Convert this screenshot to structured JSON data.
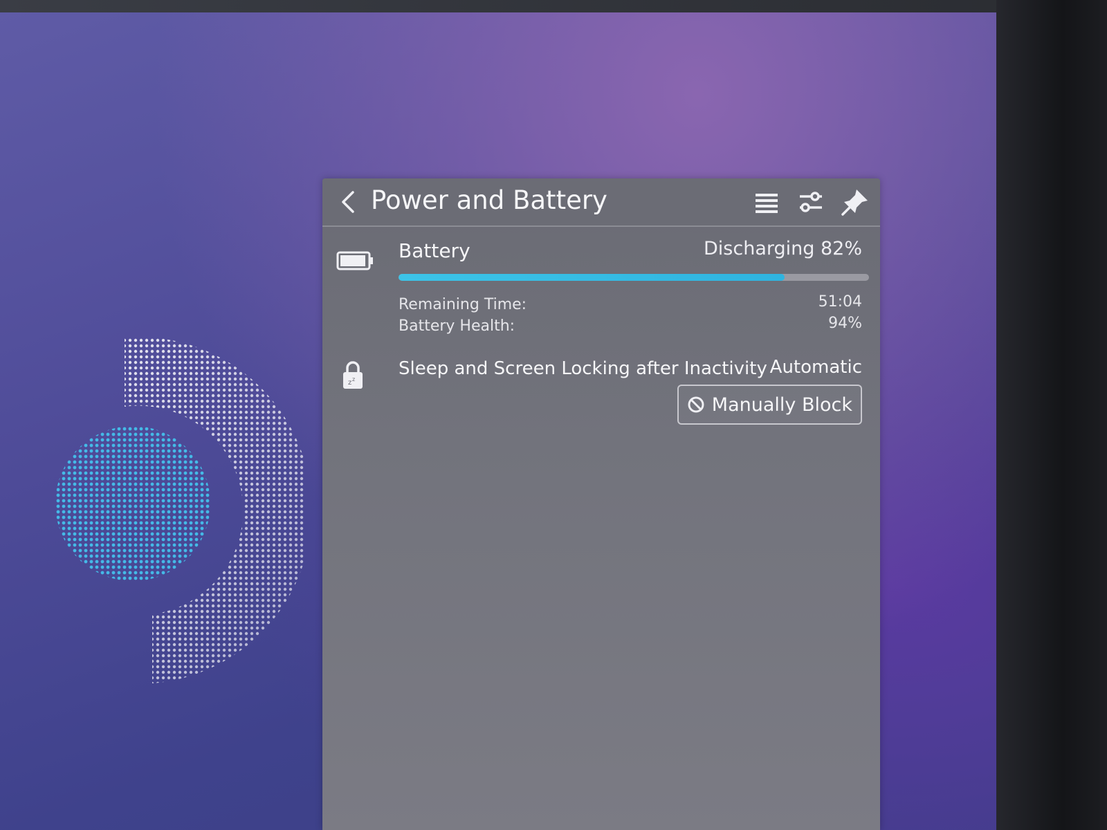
{
  "panel": {
    "title": "Power and Battery"
  },
  "battery": {
    "name": "Battery",
    "status": "Discharging 82%",
    "charge_percent": 82,
    "remaining_time_label": "Remaining Time:",
    "remaining_time_value": "51:04",
    "health_label": "Battery Health:",
    "health_value": "94%"
  },
  "sleep": {
    "label": "Sleep and Screen Locking after Inactivity",
    "value": "Automatic",
    "button_label": "Manually Block"
  },
  "colors": {
    "progress_accent": "#3cc4e8",
    "panel_background": "#6b6c75",
    "text": "#f6f6f8"
  },
  "icons": {
    "back": "back-arrow-icon",
    "menu": "hamburger-menu-icon",
    "config": "sliders-config-icon",
    "pin": "pin-icon",
    "battery": "battery-icon",
    "lock": "sleep-lock-icon",
    "block": "block-icon"
  }
}
